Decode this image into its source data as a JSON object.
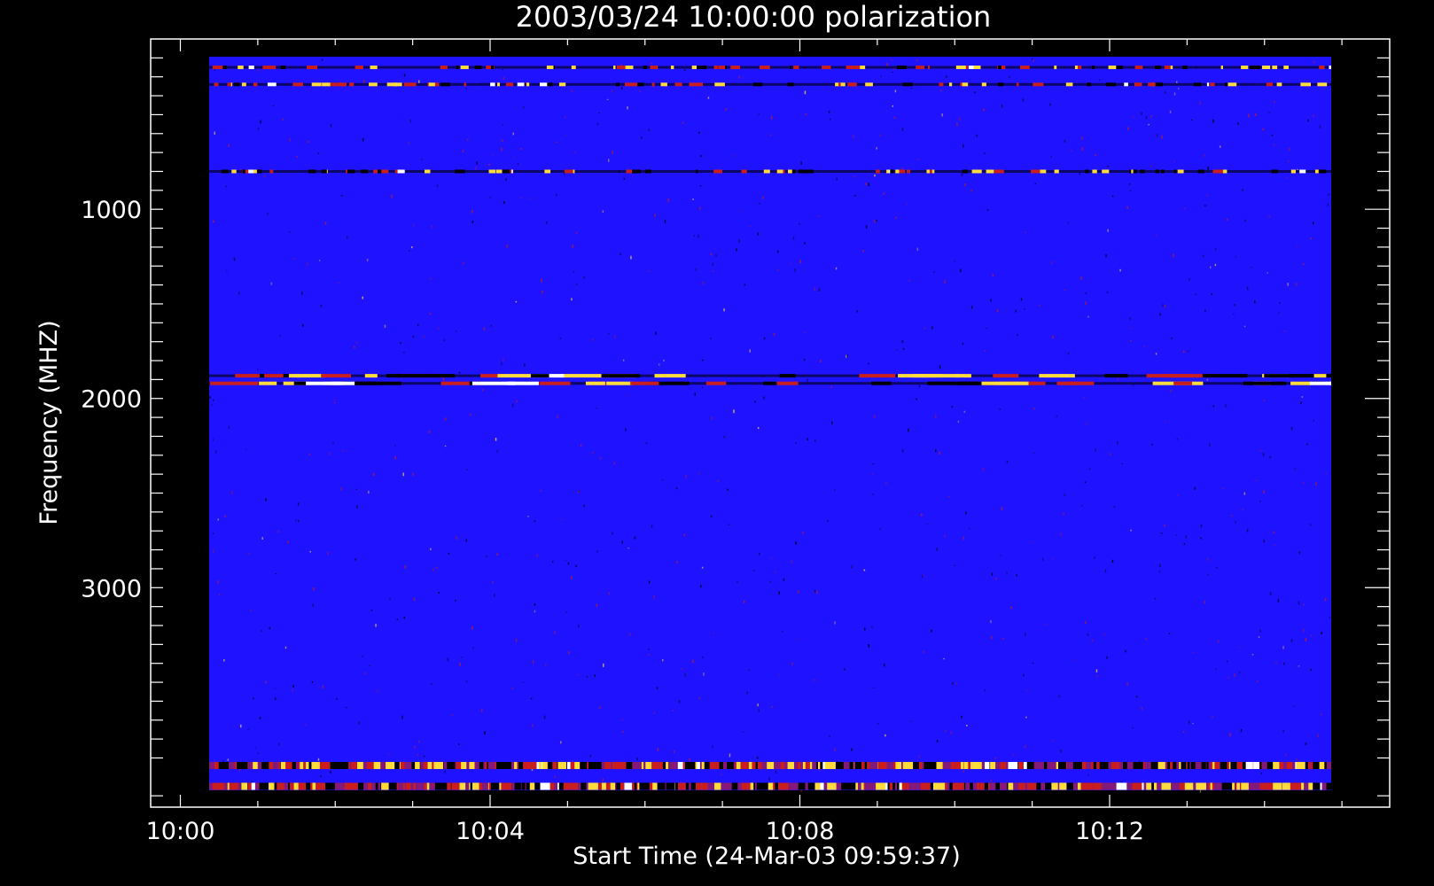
{
  "chart_data": {
    "type": "heatmap",
    "title": "2003/03/24 10:00:00 polarization",
    "xlabel": "Start Time (24-Mar-03 09:59:37)",
    "ylabel": "Frequency (MHZ)",
    "x_ticks": [
      "10:00",
      "10:04",
      "10:08",
      "10:12"
    ],
    "y_ticks": [
      "1000",
      "2000",
      "3000"
    ],
    "x_range": [
      "09:59:37",
      "10:15:37"
    ],
    "x_data_range": [
      "10:00:00",
      "10:15:00"
    ],
    "y_range": [
      100,
      4160
    ],
    "y_inverted": true,
    "colormap": {
      "background": "#1f12ff",
      "low": "#000000",
      "mid": "#c81e1e",
      "high": "#ffdc3c",
      "peak": "#ffffff"
    },
    "features": [
      {
        "freq_mhz": 250,
        "kind": "narrow interference line"
      },
      {
        "freq_mhz": 340,
        "kind": "narrow interference line"
      },
      {
        "freq_mhz": 800,
        "kind": "narrow interference line"
      },
      {
        "freq_mhz": 1880,
        "kind": "bright band"
      },
      {
        "freq_mhz": 1920,
        "kind": "bright band"
      },
      {
        "freq_mhz": 3940,
        "kind": "edge noise band"
      },
      {
        "freq_mhz": 4050,
        "kind": "edge noise band"
      }
    ]
  }
}
